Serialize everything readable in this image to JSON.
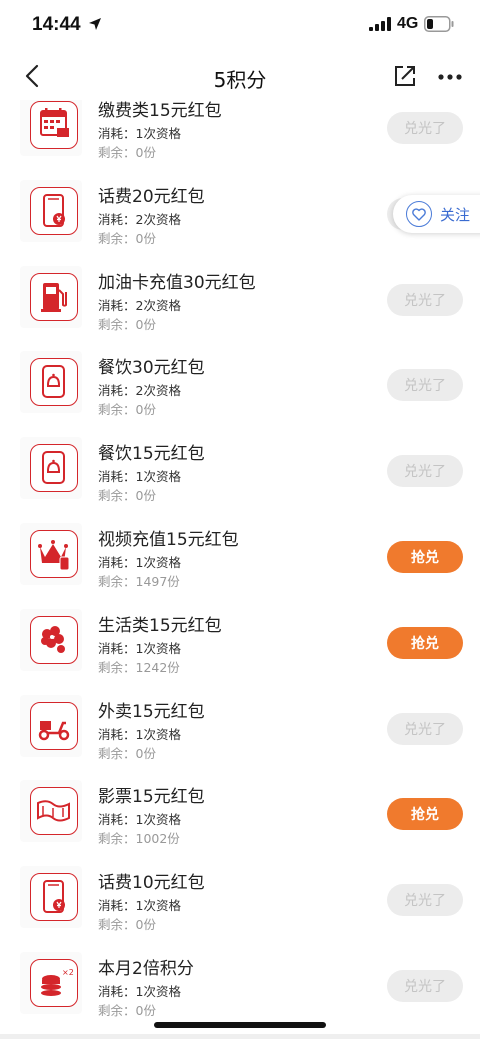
{
  "status_bar": {
    "time": "14:44",
    "network": "4G"
  },
  "nav": {
    "title": "5积分",
    "back_icon": "chevron-left-icon",
    "share_icon": "share-icon",
    "more_icon": "more-icon"
  },
  "follow": {
    "label": "关注",
    "icon": "heart-icon",
    "accent": "#3a6bd0"
  },
  "colors": {
    "primary_red": "#d4262b",
    "action_orange": "#f07a2d",
    "disabled_bg": "#ececec",
    "disabled_text": "#c4c4c4"
  },
  "items": [
    {
      "icon": "calendar-icon",
      "title": "缴费类15元红包",
      "cost": "消耗：1次资格",
      "remain": "剩余：0份",
      "button": "兑光了",
      "status": "gone"
    },
    {
      "icon": "phone-yen-icon",
      "title": "话费20元红包",
      "cost": "消耗：2次资格",
      "remain": "剩余：0份",
      "button": "兑光了",
      "status": "gone"
    },
    {
      "icon": "fuel-pump-icon",
      "title": "加油卡充值30元红包",
      "cost": "消耗：2次资格",
      "remain": "剩余：0份",
      "button": "兑光了",
      "status": "gone"
    },
    {
      "icon": "food-phone-icon",
      "title": "餐饮30元红包",
      "cost": "消耗：2次资格",
      "remain": "剩余：0份",
      "button": "兑光了",
      "status": "gone"
    },
    {
      "icon": "food-phone-icon",
      "title": "餐饮15元红包",
      "cost": "消耗：1次资格",
      "remain": "剩余：0份",
      "button": "兑光了",
      "status": "gone"
    },
    {
      "icon": "crown-icon",
      "title": "视频充值15元红包",
      "cost": "消耗：1次资格",
      "remain": "剩余：1497份",
      "button": "抢兑",
      "status": "available"
    },
    {
      "icon": "flower-icon",
      "title": "生活类15元红包",
      "cost": "消耗：1次资格",
      "remain": "剩余：1242份",
      "button": "抢兑",
      "status": "available"
    },
    {
      "icon": "scooter-icon",
      "title": "外卖15元红包",
      "cost": "消耗：1次资格",
      "remain": "剩余：0份",
      "button": "兑光了",
      "status": "gone"
    },
    {
      "icon": "film-icon",
      "title": "影票15元红包",
      "cost": "消耗：1次资格",
      "remain": "剩余：1002份",
      "button": "抢兑",
      "status": "available"
    },
    {
      "icon": "phone-yen-icon",
      "title": "话费10元红包",
      "cost": "消耗：1次资格",
      "remain": "剩余：0份",
      "button": "兑光了",
      "status": "gone"
    },
    {
      "icon": "coins-x2-icon",
      "title": "本月2倍积分",
      "cost": "消耗：1次资格",
      "remain": "剩余：0份",
      "button": "兑光了",
      "status": "gone"
    }
  ]
}
